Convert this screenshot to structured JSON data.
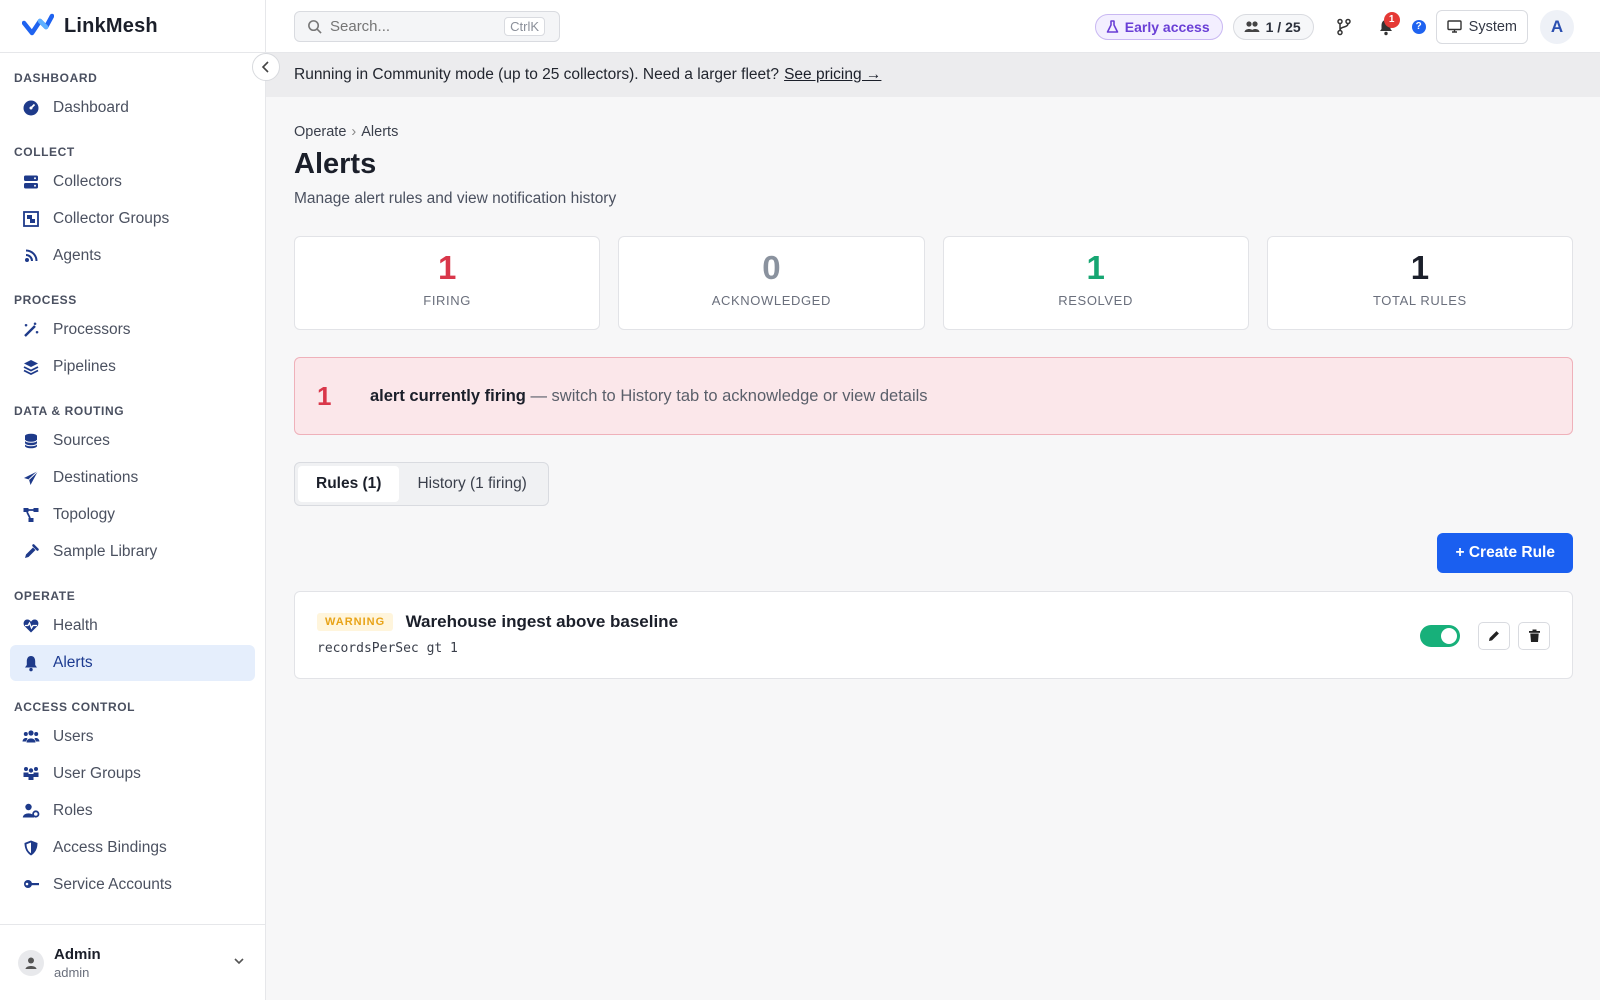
{
  "app": {
    "name": "LinkMesh"
  },
  "search": {
    "placeholder": "Search...",
    "shortcut": "CtrlK"
  },
  "topbar": {
    "early_access": "Early access",
    "collectors_count": "1 / 25",
    "notifications_count": "1",
    "help": "?",
    "system_label": "System",
    "avatar_letter": "A"
  },
  "banner": {
    "text": "Running in Community mode (up to 25 collectors). Need a larger fleet?",
    "link": "See pricing →"
  },
  "sidebar": {
    "sections": [
      {
        "title": "DASHBOARD",
        "items": [
          {
            "label": "Dashboard",
            "icon": "dashboard-icon"
          }
        ]
      },
      {
        "title": "COLLECT",
        "items": [
          {
            "label": "Collectors",
            "icon": "server-icon"
          },
          {
            "label": "Collector Groups",
            "icon": "object-group-icon"
          },
          {
            "label": "Agents",
            "icon": "signal-icon"
          }
        ]
      },
      {
        "title": "PROCESS",
        "items": [
          {
            "label": "Processors",
            "icon": "wand-icon"
          },
          {
            "label": "Pipelines",
            "icon": "layers-icon"
          }
        ]
      },
      {
        "title": "DATA & ROUTING",
        "items": [
          {
            "label": "Sources",
            "icon": "database-icon"
          },
          {
            "label": "Destinations",
            "icon": "paper-plane-icon"
          },
          {
            "label": "Topology",
            "icon": "topology-icon"
          },
          {
            "label": "Sample Library",
            "icon": "eyedropper-icon"
          }
        ]
      },
      {
        "title": "OPERATE",
        "items": [
          {
            "label": "Health",
            "icon": "heart-pulse-icon"
          },
          {
            "label": "Alerts",
            "icon": "bell-icon",
            "active": true
          }
        ]
      },
      {
        "title": "ACCESS CONTROL",
        "items": [
          {
            "label": "Users",
            "icon": "users-icon"
          },
          {
            "label": "User Groups",
            "icon": "people-group-icon"
          },
          {
            "label": "Roles",
            "icon": "user-tag-icon"
          },
          {
            "label": "Access Bindings",
            "icon": "shield-icon"
          },
          {
            "label": "Service Accounts",
            "icon": "key-icon"
          }
        ]
      }
    ],
    "footer": {
      "name": "Admin",
      "role": "admin"
    }
  },
  "page": {
    "breadcrumb": [
      "Operate",
      "Alerts"
    ],
    "title": "Alerts",
    "subtitle": "Manage alert rules and view notification history"
  },
  "stats": [
    {
      "value": "1",
      "label": "FIRING",
      "color": "#d9374a"
    },
    {
      "value": "0",
      "label": "ACKNOWLEDGED",
      "color": "#8a929e"
    },
    {
      "value": "1",
      "label": "RESOLVED",
      "color": "#16a672"
    },
    {
      "value": "1",
      "label": "TOTAL RULES",
      "color": "#1b1f2a"
    }
  ],
  "firing_banner": {
    "count": "1",
    "bold": "alert currently firing",
    "text": " — switch to History tab to acknowledge or view details"
  },
  "tabs": [
    {
      "label": "Rules (1)",
      "active": true
    },
    {
      "label": "History (1 firing)"
    }
  ],
  "create_button": "+ Create Rule",
  "rules": [
    {
      "severity": "WARNING",
      "name": "Warehouse ingest above baseline",
      "expr": "recordsPerSec gt 1",
      "enabled": true
    }
  ],
  "colors": {
    "accent": "#1a5ff0",
    "active_nav_bg": "#e5eefc",
    "toggle_on": "#17b07a"
  }
}
